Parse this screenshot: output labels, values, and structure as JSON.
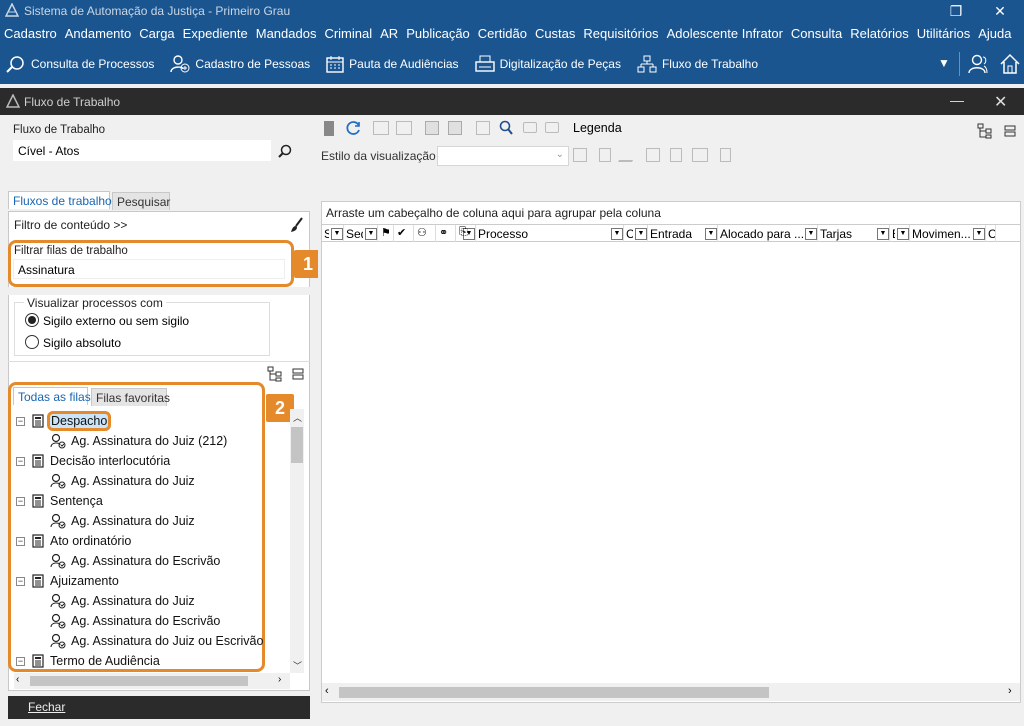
{
  "app": {
    "title": "Sistema de Automação da Justiça - Primeiro Grau"
  },
  "menu": [
    "Cadastro",
    "Andamento",
    "Carga",
    "Expediente",
    "Mandados",
    "Criminal",
    "AR",
    "Publicação",
    "Certidão",
    "Custas",
    "Requisitórios",
    "Adolescente Infrator",
    "Consulta",
    "Relatórios",
    "Utilitários",
    "Ajuda"
  ],
  "toolbar": {
    "consulta": "Consulta de Processos",
    "cadastro": "Cadastro de Pessoas",
    "pauta": "Pauta de Audiências",
    "digitalizacao": "Digitalização de Peças",
    "fluxo": "Fluxo de Trabalho"
  },
  "window": {
    "title": "Fluxo de Trabalho"
  },
  "left": {
    "fluxo_label": "Fluxo de Trabalho",
    "fluxo_value": "Cível - Atos",
    "tab_fluxos": "Fluxos de trabalho",
    "tab_pesquisar": "Pesquisar",
    "filtro_conteudo": "Filtro de conteúdo >>",
    "filtrar_label": "Filtrar filas de trabalho",
    "filtrar_value": "Assinatura",
    "visualizar_label": "Visualizar processos com",
    "radio1": "Sigilo externo ou sem sigilo",
    "radio2": "Sigilo absoluto",
    "radio_selected": "radio1",
    "tab_todas": "Todas as filas",
    "tab_favoritas": "Filas favoritas",
    "fechar": "Fechar"
  },
  "badges": {
    "one": "1",
    "two": "2"
  },
  "tree": [
    {
      "label": "Despacho",
      "level": 0,
      "selected": true
    },
    {
      "label": "Ag. Assinatura do Juiz (212)",
      "level": 1
    },
    {
      "label": "Decisão interlocutória",
      "level": 0
    },
    {
      "label": "Ag. Assinatura do Juiz",
      "level": 1
    },
    {
      "label": "Sentença",
      "level": 0
    },
    {
      "label": "Ag. Assinatura do Juiz",
      "level": 1
    },
    {
      "label": "Ato ordinatório",
      "level": 0
    },
    {
      "label": "Ag. Assinatura do Escrivão",
      "level": 1
    },
    {
      "label": "Ajuizamento",
      "level": 0
    },
    {
      "label": "Ag. Assinatura do Juiz",
      "level": 1
    },
    {
      "label": "Ag. Assinatura do Escrivão",
      "level": 1
    },
    {
      "label": "Ag. Assinatura do Juiz ou Escrivão",
      "level": 1
    },
    {
      "label": "Termo de Audiência",
      "level": 0
    }
  ],
  "right": {
    "legenda": "Legenda",
    "estilo_label": "Estilo da visualização",
    "group_hint": "Arraste um cabeçalho de coluna aqui para agrupar pela coluna",
    "columns": [
      "S...",
      "Seq.",
      "",
      "",
      "",
      "",
      "",
      "Processo",
      "C...",
      "Entrada",
      "Alocado para ...",
      "Tarjas",
      "E...",
      "Movimen...",
      "C"
    ]
  },
  "colors": {
    "accent": "#1a5590",
    "highlight": "#e58a2a"
  }
}
